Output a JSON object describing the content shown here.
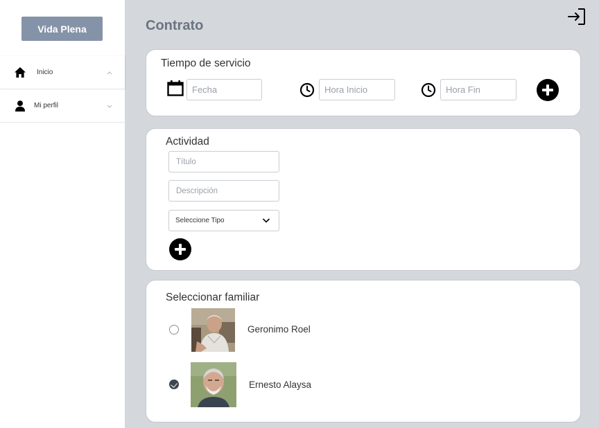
{
  "sidebar": {
    "brand": "Vida Plena",
    "items": [
      {
        "label": "Inicio",
        "icon": "home-icon",
        "chevron": "^"
      },
      {
        "label": "Mi perfil",
        "icon": "user-icon",
        "chevron": "v"
      }
    ]
  },
  "header": {
    "title": "Contrato",
    "logout_icon": "logout-icon"
  },
  "service_time": {
    "title": "Tiempo de servicio",
    "date_placeholder": "Fecha",
    "start_placeholder": "Hora Inicio",
    "end_placeholder": "Hora Fin",
    "add_icon": "plus-circle-icon"
  },
  "activity": {
    "title": "Actividad",
    "title_placeholder": "Título",
    "description_placeholder": "Descripción",
    "type_select": "Seleccione Tipo",
    "add_icon": "plus-circle-icon"
  },
  "family": {
    "title": "Seleccionar familiar",
    "members": [
      {
        "name": "Geronimo Roel",
        "selected": false
      },
      {
        "name": "Ernesto Alaysa",
        "selected": true
      }
    ]
  },
  "colors": {
    "background": "#d4d7dc",
    "brand": "#8593a8",
    "title": "#6b7480"
  }
}
